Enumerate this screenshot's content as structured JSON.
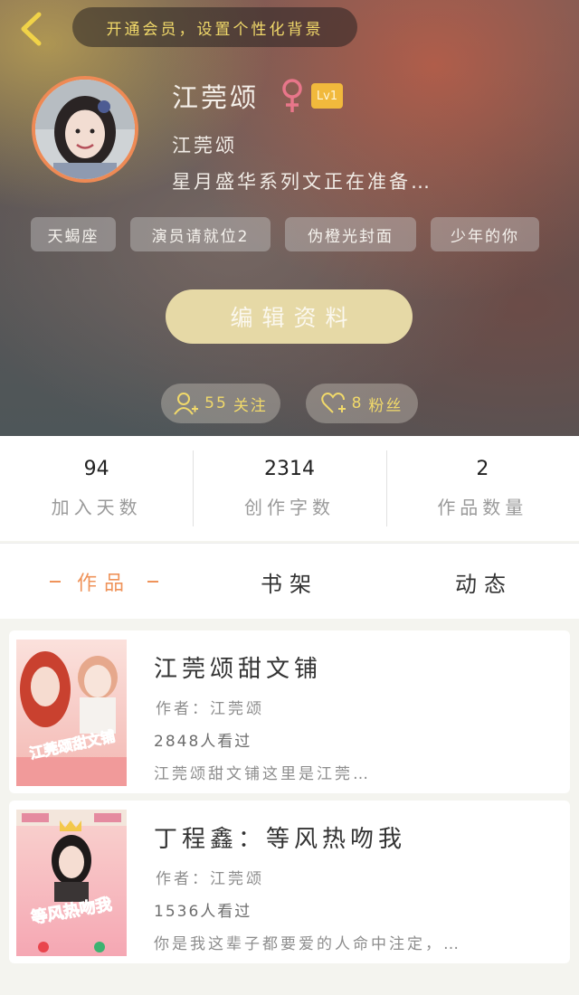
{
  "header": {
    "vip_banner": "开通会员，设置个性化背景",
    "username": "江莞颂",
    "gender_symbol": "♀",
    "level": "Lv1",
    "nickname": "江莞颂",
    "bio": "星月盛华系列文正在准备…",
    "tags": [
      "天蝎座",
      "演员请就位2",
      "伪橙光封面",
      "少年的你"
    ],
    "edit_button": "编辑资料",
    "follow": {
      "count": "55",
      "label": "关注"
    },
    "fans": {
      "count": "8",
      "label": "粉丝"
    }
  },
  "stats": [
    {
      "value": "94",
      "label": "加入天数"
    },
    {
      "value": "2314",
      "label": "创作字数"
    },
    {
      "value": "2",
      "label": "作品数量"
    }
  ],
  "tabs": [
    {
      "label": "作品",
      "active": true
    },
    {
      "label": "书架",
      "active": false
    },
    {
      "label": "动态",
      "active": false
    }
  ],
  "books": [
    {
      "title": "江莞颂甜文铺",
      "author": "作者：江莞颂",
      "views": "2848人看过",
      "description": "江莞颂甜文铺这里是江莞…",
      "cover_text": "江莞颂甜文铺"
    },
    {
      "title": "丁程鑫：等风热吻我",
      "author": "作者：江莞颂",
      "views": "1536人看过",
      "description": "你是我这辈子都要爱的人命中注定，…",
      "cover_text": "等风热吻我"
    }
  ],
  "colors": {
    "accent_orange": "#ef935a",
    "vip_yellow": "#f1d96a",
    "level_badge": "#f1b93c",
    "edit_button": "#e6d9a6",
    "gender_pink": "#e8768a"
  }
}
